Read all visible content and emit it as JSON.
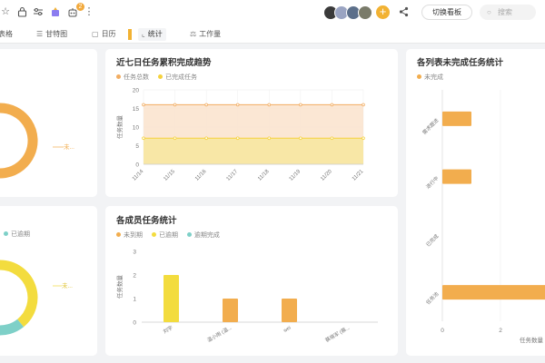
{
  "toolbar": {
    "notification_count": "2",
    "switch_button_label": "切换看板",
    "search_placeholder": "搜索",
    "colors": {
      "accent": "#f2b233"
    }
  },
  "view_tabs": [
    {
      "label": "表格",
      "icon": "table-icon"
    },
    {
      "label": "甘特图",
      "icon": "gantt-icon"
    },
    {
      "label": "日历",
      "icon": "calendar-icon"
    },
    {
      "label": "统计",
      "icon": "stats-icon",
      "active": true
    },
    {
      "label": "工作量",
      "icon": "workload-icon"
    }
  ],
  "cards": {
    "donut_top": {
      "label": "未..."
    },
    "donut_bottom": {
      "legend": "已逾期",
      "label": "未..."
    },
    "trend": {
      "title": "近七日任务累积完成趋势",
      "legend": [
        "任务总数",
        "已完成任务"
      ]
    },
    "member": {
      "title": "各成员任务统计",
      "legend": [
        "未到期",
        "已逾期",
        "逾期完成"
      ]
    },
    "list": {
      "title": "各列表未完成任务统计",
      "legend": [
        "未完成"
      ]
    }
  },
  "chart_data": [
    {
      "type": "area",
      "title": "近七日任务累积完成趋势",
      "xlabel": "",
      "ylabel": "任务数量",
      "categories": [
        "11/14",
        "11/15",
        "11/16",
        "11/17",
        "11/18",
        "11/19",
        "11/20",
        "11/21"
      ],
      "ylim": [
        0,
        20
      ],
      "yticks": [
        0,
        5,
        10,
        15,
        20
      ],
      "series": [
        {
          "name": "任务总数",
          "values": [
            16,
            16,
            16,
            16,
            16,
            16,
            16,
            16
          ],
          "color": "#f2ad62"
        },
        {
          "name": "已完成任务",
          "values": [
            7,
            7,
            7,
            7,
            7,
            7,
            7,
            7
          ],
          "color": "#f5d23e"
        }
      ],
      "grid": true,
      "legend": "top-left"
    },
    {
      "type": "bar",
      "title": "各成员任务统计",
      "ylabel": "任务数量",
      "categories": [
        "刘宇",
        "温小雨 (温...",
        "wei",
        "蔡晓军 (蔡..."
      ],
      "ylim": [
        0,
        3
      ],
      "yticks": [
        0,
        1,
        2,
        3
      ],
      "series": [
        {
          "name": "未到期",
          "values": [
            0,
            1,
            1,
            0
          ],
          "color": "#f2ad4e"
        },
        {
          "name": "已逾期",
          "values": [
            2,
            0,
            0,
            0
          ],
          "color": "#f3dc3e"
        },
        {
          "name": "逾期完成",
          "values": [
            0,
            0,
            0,
            0
          ],
          "color": "#7ed0c8"
        }
      ],
      "legend": "top-left"
    },
    {
      "type": "bar",
      "orientation": "horizontal",
      "title": "各列表未完成任务统计",
      "xlabel": "任务数量",
      "categories": [
        "需求跟进",
        "进行中",
        "已完成",
        "任务池"
      ],
      "series": [
        {
          "name": "未完成",
          "values": [
            1,
            1,
            0,
            4
          ],
          "color": "#f2ad4e"
        }
      ],
      "xlim": [
        0,
        4
      ],
      "xticks": [
        0,
        2
      ],
      "legend": "top-left"
    },
    {
      "type": "pie",
      "slices": [
        {
          "label": "未...",
          "value": 95,
          "color": "#f2ad4e"
        },
        {
          "label": "",
          "value": 5,
          "color": "#f3dc3e"
        }
      ]
    },
    {
      "type": "pie",
      "legend_entries": [
        "已逾期"
      ],
      "slices": [
        {
          "label": "未...",
          "value": 55,
          "color": "#f3dc3e"
        },
        {
          "label": "已逾期",
          "value": 25,
          "color": "#7ed0c8"
        },
        {
          "label": "",
          "value": 20,
          "color": "#f2ad4e"
        }
      ]
    }
  ]
}
